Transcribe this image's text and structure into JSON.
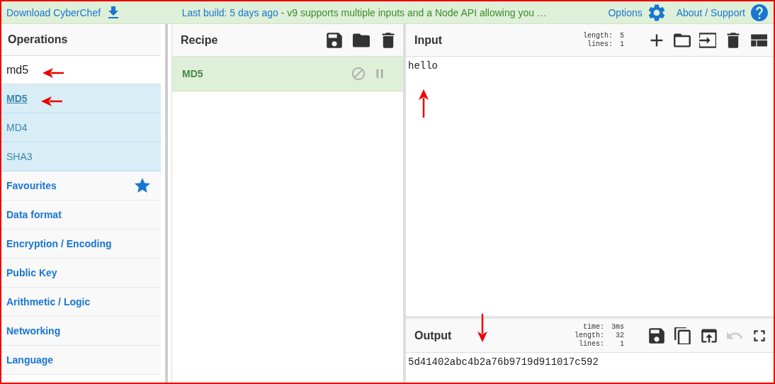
{
  "top_bar": {
    "download": "Download CyberChef",
    "notice": {
      "build": "Last build: 5 days ago",
      "message": " - v9 supports multiple inputs and a Node API allowing you …"
    },
    "options": "Options",
    "about": "About / Support"
  },
  "operations": {
    "title": "Operations",
    "search": {
      "value": "md5",
      "marked": true
    },
    "results": [
      {
        "label": "MD5",
        "selected": true,
        "marked": true
      },
      {
        "label": "MD4",
        "selected": false
      },
      {
        "label": "SHA3",
        "selected": false
      }
    ],
    "categories": [
      {
        "label": "Favourites",
        "kind": "favourites"
      },
      {
        "label": "Data format",
        "kind": "category"
      },
      {
        "label": "Encryption / Encoding",
        "kind": "category"
      },
      {
        "label": "Public Key",
        "kind": "category"
      },
      {
        "label": "Arithmetic / Logic",
        "kind": "category"
      },
      {
        "label": "Networking",
        "kind": "category"
      },
      {
        "label": "Language",
        "kind": "category"
      }
    ]
  },
  "recipe": {
    "title": "Recipe",
    "steps": [
      {
        "label": "MD5",
        "disabled": false,
        "paused": false
      }
    ]
  },
  "input": {
    "title": "Input",
    "stats": [
      {
        "label": "length:",
        "value": "5"
      },
      {
        "label": "lines:",
        "value": "1"
      }
    ],
    "text": "hello",
    "marked": true
  },
  "output": {
    "title": "Output",
    "stats": [
      {
        "label": "time:",
        "value": "3ms"
      },
      {
        "label": "length:",
        "value": "32"
      },
      {
        "label": "lines:",
        "value": "1"
      }
    ],
    "text": "5d41402abc4b2a76b9719d911017c592",
    "marked": true,
    "undo_disabled": true
  }
}
